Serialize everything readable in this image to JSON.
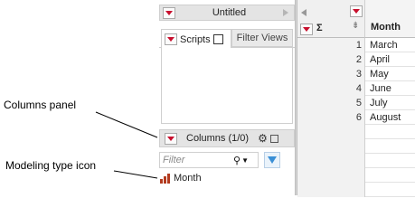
{
  "annotations": {
    "columns_panel": "Columns panel",
    "modeling_type_icon": "Modeling type icon"
  },
  "table_panel": {
    "title": "Untitled"
  },
  "tabs": {
    "scripts": "Scripts",
    "filter_views": "Filter Views"
  },
  "columns_panel": {
    "title": "Columns (1/0)",
    "filter_placeholder": "Filter",
    "columns": [
      {
        "name": "Month",
        "modeling_type_icon": "ordinal-icon"
      }
    ]
  },
  "grid": {
    "column_header": "Month",
    "rows": [
      {
        "num": "1",
        "month": "March"
      },
      {
        "num": "2",
        "month": "April"
      },
      {
        "num": "3",
        "month": "May"
      },
      {
        "num": "4",
        "month": "June"
      },
      {
        "num": "5",
        "month": "July"
      },
      {
        "num": "6",
        "month": "August"
      }
    ]
  },
  "colors": {
    "accent_red": "#c8102e",
    "ordinal_icon": "#b33b1f",
    "filter_blue": "#3a8fd6"
  }
}
